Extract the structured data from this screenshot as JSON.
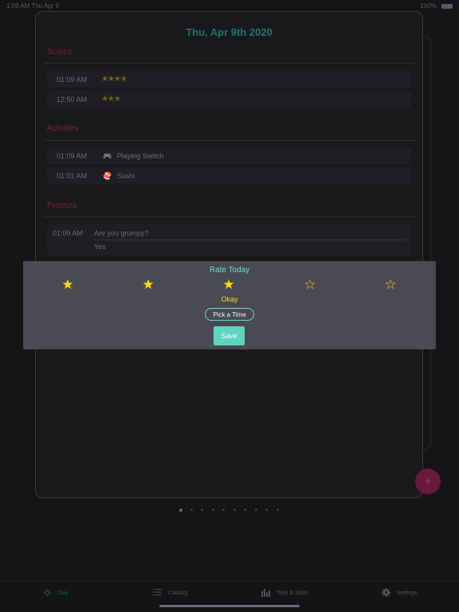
{
  "status_bar": {
    "time": "1:09 AM",
    "date": "Thu Apr 9",
    "battery": "100%"
  },
  "day": {
    "title": "Thu, Apr 9th 2020",
    "scores_heading": "Scores",
    "scores": [
      {
        "time": "01:09 AM",
        "stars": "★★★★",
        "rating": 4
      },
      {
        "time": "12:50 AM",
        "stars": "★★★",
        "rating": 3
      }
    ],
    "activities_heading": "Activities",
    "activities": [
      {
        "time": "01:09 AM",
        "icon": "🎮",
        "icon_name": "game-controller-icon",
        "label": "Playing Switch"
      },
      {
        "time": "01:01 AM",
        "icon": "🍣",
        "icon_name": "sushi-icon",
        "label": "Sushi"
      }
    ],
    "prompts_heading": "Prompts",
    "prompts": [
      {
        "time": "01:09 AM",
        "question": "Are you grumpy?",
        "answer": "Yes"
      }
    ]
  },
  "rating_modal": {
    "title": "Rate Today",
    "rating": 3,
    "max_rating": 5,
    "rating_label": "Okay",
    "pick_time_label": "Pick a Time",
    "save_label": "Save"
  },
  "fab": {
    "label": "+"
  },
  "pagination": {
    "total": 10,
    "current": 1
  },
  "tabs": [
    {
      "label": "Day",
      "icon": "sun-icon",
      "active": true
    },
    {
      "label": "Catalog",
      "icon": "list-icon",
      "active": false
    },
    {
      "label": "Tiles & Stats",
      "icon": "bar-chart-icon",
      "active": false
    },
    {
      "label": "Settings",
      "icon": "gear-icon",
      "active": false
    }
  ],
  "colors": {
    "accent": "#5ed6bd",
    "title_green": "#1b7a66",
    "section_red": "#7a2140",
    "star_yellow": "#ffdd00",
    "fab": "#6b1a3d"
  }
}
